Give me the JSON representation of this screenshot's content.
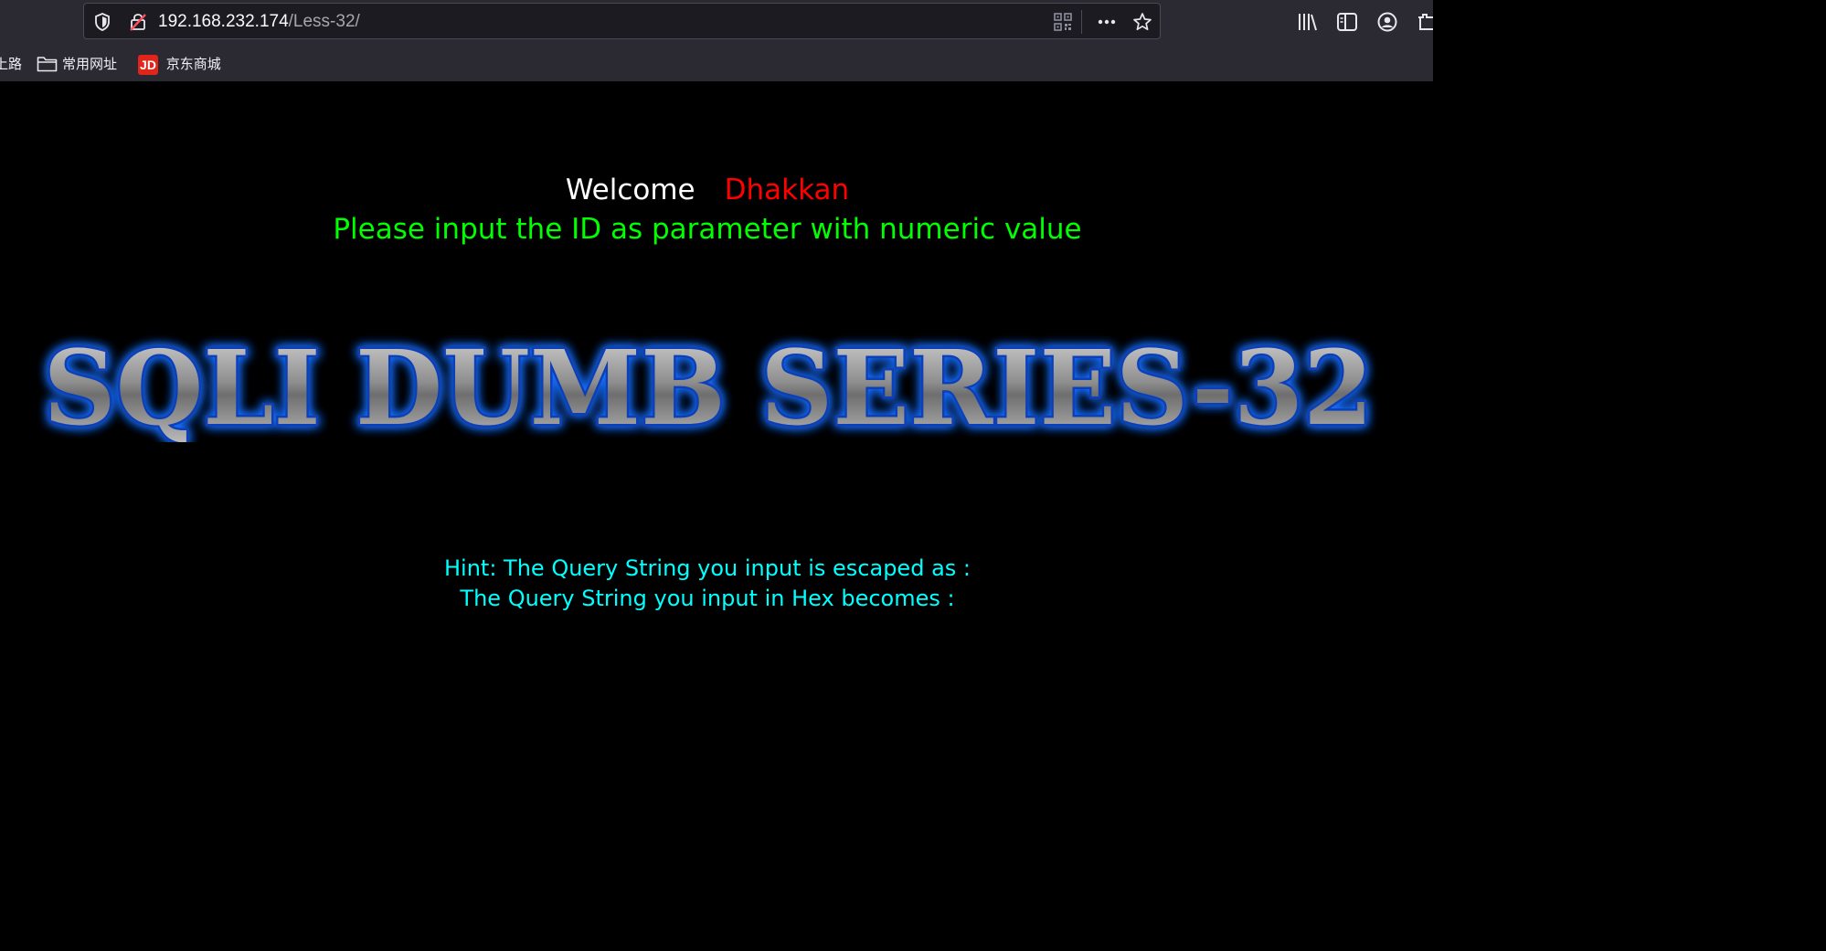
{
  "browser": {
    "url_host": "192.168.232.174",
    "url_path": "/Less-32/",
    "bookmarks": [
      {
        "label": "上路",
        "icon": "bookmark-icon"
      },
      {
        "label": "常用网址",
        "icon": "folder-icon"
      },
      {
        "label": "京东商城",
        "icon": "jd-logo-icon"
      }
    ],
    "jd_badge": "JD",
    "icons": [
      "shield-icon",
      "insecure-lock-icon",
      "qr-code-icon",
      "more-icon",
      "star-icon",
      "library-icon",
      "sidebar-icon",
      "account-icon",
      "extension-icon"
    ]
  },
  "page": {
    "welcome_label": "Welcome",
    "welcome_user": "Dhakkan",
    "instruction": "Please input the ID as parameter with numeric value",
    "banner_text": "SQLI DUMB SERIES-32",
    "hint_escaped": "Hint: The Query String you input is escaped as :",
    "hint_hex": "The Query String you input in Hex becomes :"
  },
  "colors": {
    "background": "#000000",
    "welcome": "#ffffff",
    "user": "#ff0000",
    "instruction": "#00ff00",
    "hint": "#00ffff",
    "banner_glow": "#1a6dff"
  }
}
